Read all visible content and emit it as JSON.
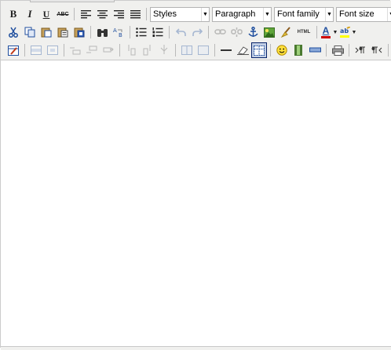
{
  "toolbar": {
    "row1": {
      "bold": "B",
      "italic": "I",
      "underline": "U",
      "strikethrough": "ABC",
      "styles_select": "Styles",
      "paragraph_select": "Paragraph",
      "fontfamily_select": "Font family",
      "fontsize_select": "Font size"
    },
    "row2": {
      "html_label": "HTML",
      "font_color_letter": "A"
    }
  },
  "colors": {
    "toolbar_bg": "#f0f0ee",
    "active_button_bg": "#c2cfe5",
    "active_button_border": "#0a246a",
    "font_color_swatch": "#cc0000",
    "highlight_swatch": "#ffff00"
  }
}
